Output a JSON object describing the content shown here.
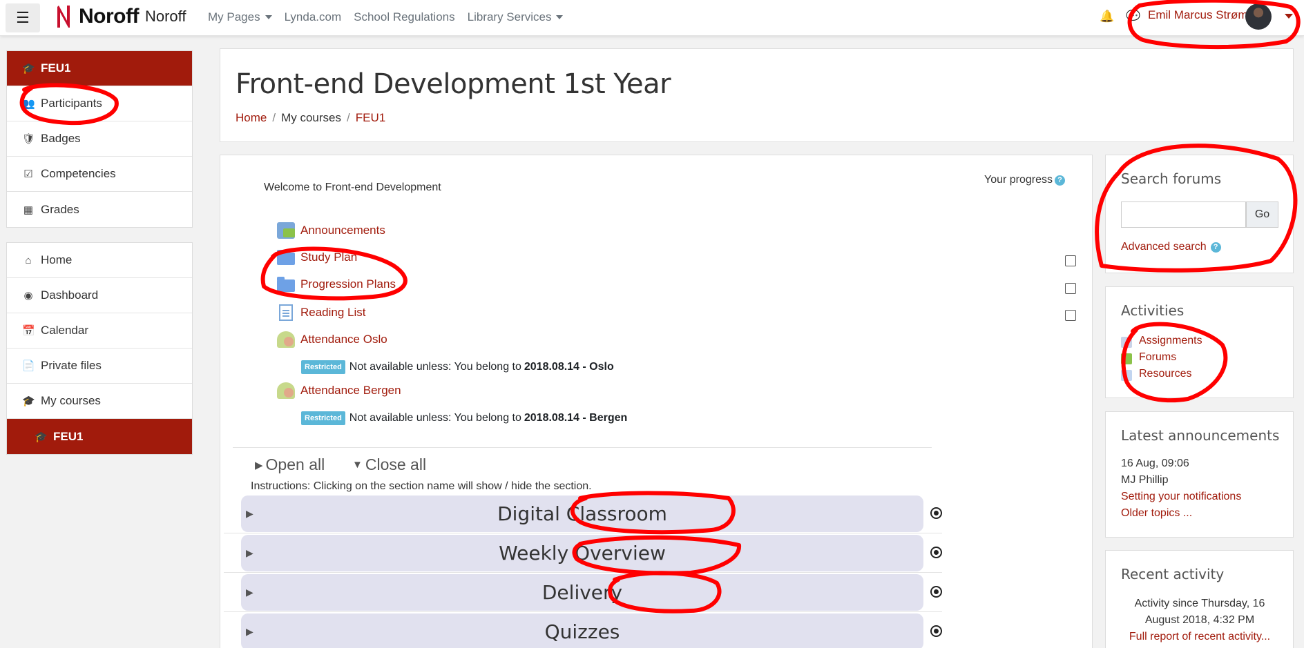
{
  "navbar": {
    "menu_icon": "hamburger-icon",
    "brand": "Noroff",
    "site_name": "Noroff",
    "links": [
      {
        "label": "My Pages",
        "dropdown": true
      },
      {
        "label": "Lynda.com",
        "dropdown": false
      },
      {
        "label": "School Regulations",
        "dropdown": false
      },
      {
        "label": "Library Services",
        "dropdown": true
      }
    ],
    "notification_icon": "bell-icon",
    "message_icon": "chat-icon",
    "user_name": "Emil Marcus Strøm"
  },
  "drawer": {
    "course_nav": [
      {
        "label": "FEU1",
        "icon": "graduation-cap-icon",
        "active": true
      },
      {
        "label": "Participants",
        "icon": "users-icon"
      },
      {
        "label": "Badges",
        "icon": "shield-icon"
      },
      {
        "label": "Competencies",
        "icon": "checkbox-icon"
      },
      {
        "label": "Grades",
        "icon": "table-icon"
      }
    ],
    "site_nav": [
      {
        "label": "Home",
        "icon": "home-icon"
      },
      {
        "label": "Dashboard",
        "icon": "dashboard-icon"
      },
      {
        "label": "Calendar",
        "icon": "calendar-icon"
      },
      {
        "label": "Private files",
        "icon": "file-icon"
      },
      {
        "label": "My courses",
        "icon": "graduation-cap-icon"
      },
      {
        "label": "FEU1",
        "icon": "graduation-cap-icon",
        "active": true
      }
    ]
  },
  "header": {
    "title": "Front-end Development 1st Year",
    "breadcrumb": [
      "Home",
      "My courses",
      "FEU1"
    ]
  },
  "course": {
    "welcome": "Welcome to Front-end Development",
    "progress_label": "Your progress",
    "activities": [
      {
        "label": "Announcements",
        "icon": "forum-icon",
        "checkbox": false
      },
      {
        "label": "Study Plan",
        "icon": "folder-icon",
        "checkbox": true
      },
      {
        "label": "Progression Plans",
        "icon": "folder-icon",
        "checkbox": true
      },
      {
        "label": "Reading List",
        "icon": "page-icon",
        "checkbox": true
      },
      {
        "label": "Attendance Oslo",
        "icon": "attendance-icon",
        "checkbox": false
      },
      {
        "label": "Attendance Bergen",
        "icon": "attendance-icon",
        "checkbox": false
      }
    ],
    "restrictions": [
      {
        "badge": "Restricted",
        "text": "Not available unless: You belong to ",
        "group": "2018.08.14 - Oslo"
      },
      {
        "badge": "Restricted",
        "text": "Not available unless: You belong to ",
        "group": "2018.08.14 - Bergen"
      }
    ],
    "open_all": "Open all",
    "close_all": "Close all",
    "instructions": "Instructions: Clicking on the section name will show / hide the section.",
    "sections": [
      "Digital Classroom",
      "Weekly Overview",
      "Delivery",
      "Quizzes"
    ]
  },
  "blocks": {
    "search_forums": {
      "title": "Search forums",
      "button": "Go",
      "advanced": "Advanced search"
    },
    "activities": {
      "title": "Activities",
      "items": [
        "Assignments",
        "Forums",
        "Resources"
      ]
    },
    "latest_announcements": {
      "title": "Latest announcements",
      "date": "16 Aug, 09:06",
      "author": "MJ Phillip",
      "post": "Setting your notifications",
      "older": "Older topics ..."
    },
    "recent_activity": {
      "title": "Recent activity",
      "since_line1": "Activity since Thursday, 16",
      "since_line2": "August 2018, 4:32 PM",
      "full_report": "Full report of recent activity..."
    }
  },
  "colors": {
    "brand": "#a11b0c",
    "section_bg": "#e1e1ef",
    "annotation": "#ff0000"
  }
}
